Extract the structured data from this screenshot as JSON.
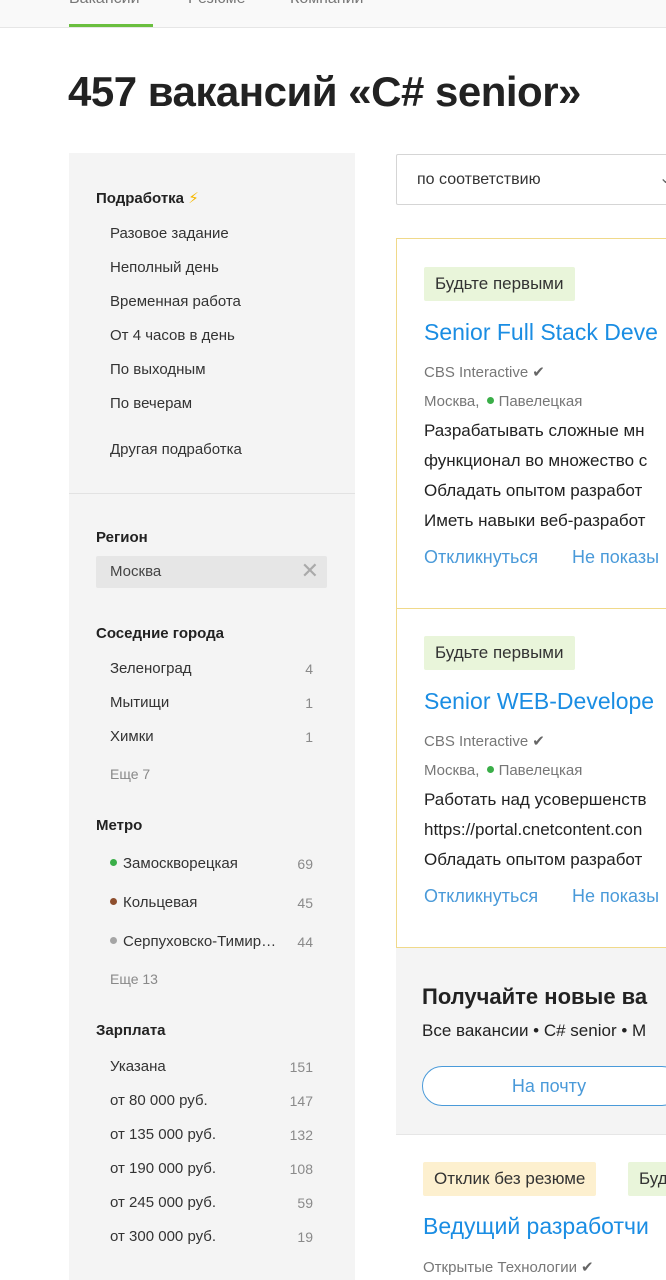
{
  "top_tabs": [
    "Вакансии",
    "Резюме",
    "Компании"
  ],
  "page_title": "457 вакансий «C# senior»",
  "sidebar": {
    "parttime": {
      "heading": "Подработка",
      "items": [
        "Разовое задание",
        "Неполный день",
        "Временная работа",
        "От 4 часов в день",
        "По выходным",
        "По вечерам",
        "Другая подработка"
      ]
    },
    "region": {
      "heading": "Регион",
      "value": "Москва"
    },
    "nearby": {
      "heading": "Соседние города",
      "items": [
        {
          "label": "Зеленоград",
          "count": "4"
        },
        {
          "label": "Мытищи",
          "count": "1"
        },
        {
          "label": "Химки",
          "count": "1"
        }
      ],
      "more": "Еще 7"
    },
    "metro": {
      "heading": "Метро",
      "items": [
        {
          "label": "Замоскворецкая",
          "count": "69",
          "color": "#3aae48"
        },
        {
          "label": "Кольцевая",
          "count": "45",
          "color": "#8d4e2d"
        },
        {
          "label": "Серпуховско-Тимир…",
          "count": "44",
          "color": "#a5a5a5"
        }
      ],
      "more": "Еще 13"
    },
    "salary": {
      "heading": "Зарплата",
      "items": [
        {
          "label": "Указана",
          "count": "151"
        },
        {
          "label": "от 80 000 руб.",
          "count": "147"
        },
        {
          "label": "от 135 000 руб.",
          "count": "132"
        },
        {
          "label": "от 190 000 руб.",
          "count": "108"
        },
        {
          "label": "от 245 000 руб.",
          "count": "59"
        },
        {
          "label": "от 300 000 руб.",
          "count": "19"
        }
      ]
    }
  },
  "sort": {
    "value": "по соответствию"
  },
  "vacancies": [
    {
      "badge": "Будьте первыми",
      "title": "Senior Full Stack Deve",
      "company": "CBS Interactive",
      "city": "Москва,",
      "metro": "Павелецкая",
      "metro_color": "#3aae48",
      "snippet": [
        "Разрабатывать сложные мн",
        "функционал во множество с",
        "Обладать опытом разработ",
        "Иметь навыки веб-разработ"
      ],
      "respond": "Откликнуться",
      "hide": "Не показы"
    },
    {
      "badge": "Будьте первыми",
      "title": "Senior WEB-Develope",
      "company": "CBS Interactive",
      "city": "Москва,",
      "metro": "Павелецкая",
      "metro_color": "#3aae48",
      "snippet": [
        "Работать над усовершенств",
        "https://portal.cnetcontent.con",
        "Обладать опытом разработ"
      ],
      "respond": "Откликнуться",
      "hide": "Не показы"
    },
    {
      "badges": [
        "Отклик без резюме",
        "Буд"
      ],
      "title": "Ведущий разработчи",
      "company": "Открытые Технологии"
    }
  ],
  "subscribe": {
    "heading": "Получайте новые ва",
    "text": "Все вакансии • C# senior • М",
    "button": "На почту"
  },
  "colors": {
    "accent_green": "#6abf3f",
    "link_blue": "#1a8de3",
    "highlight_border": "#f0d98a"
  },
  "icons": {
    "lightning": "⚡",
    "check": "✔",
    "close": "✕",
    "chevron": "⌄"
  }
}
